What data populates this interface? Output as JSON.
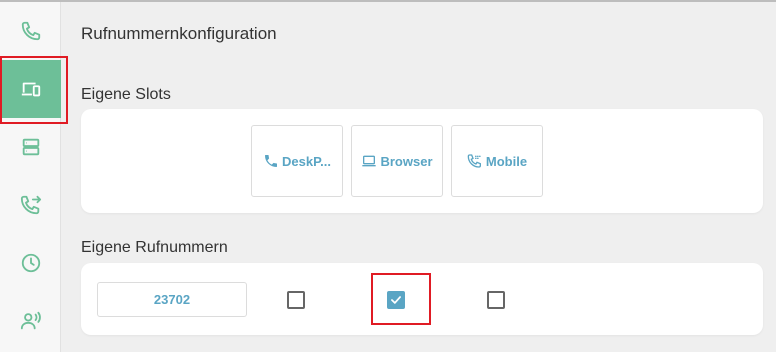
{
  "main": {
    "title": "Rufnummernkonfiguration",
    "slots_section": {
      "title": "Eigene Slots",
      "slots": [
        {
          "label": "DeskP...",
          "icon": "phone-icon"
        },
        {
          "label": "Browser",
          "icon": "laptop-icon"
        },
        {
          "label": "Mobile",
          "icon": "phone-in-talk-icon"
        }
      ]
    },
    "numbers_section": {
      "title": "Eigene Rufnummern",
      "number": "23702",
      "checkboxes": [
        false,
        true,
        false
      ]
    }
  },
  "sidebar": {
    "items": [
      {
        "icon": "phone-icon"
      },
      {
        "icon": "devices-icon",
        "active": true
      },
      {
        "icon": "server-icon"
      },
      {
        "icon": "phone-forward-icon"
      },
      {
        "icon": "clock-icon"
      },
      {
        "icon": "voice-icon"
      }
    ]
  },
  "colors": {
    "accent": "#6dbf98",
    "link": "#5aa5c4",
    "highlight": "#e01b24"
  }
}
